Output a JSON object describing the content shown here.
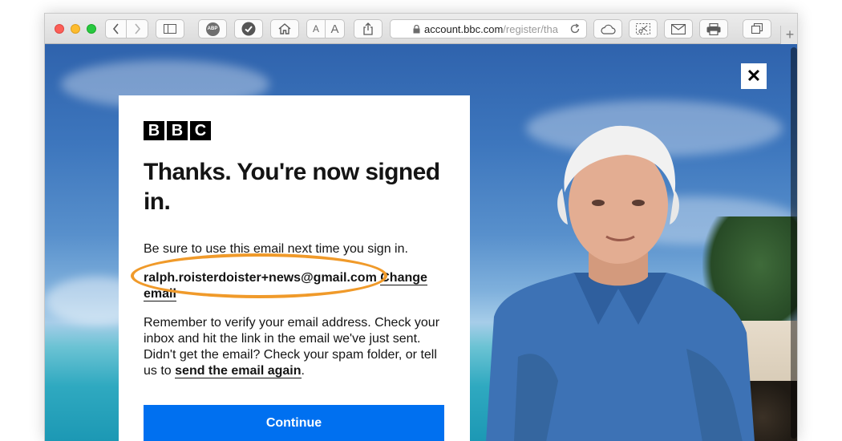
{
  "browser": {
    "address_bar": {
      "host": "account.bbc.com",
      "path_tail": "/register/tha"
    },
    "toolbar_buttons": {
      "adblock_label": "ABP",
      "font_small_label": "A",
      "font_large_label": "A",
      "new_tab_label": "+"
    }
  },
  "page": {
    "close_label": "✕",
    "logo_letters": [
      "B",
      "B",
      "C"
    ],
    "heading": "Thanks. You're now signed in.",
    "intro_text": "Be sure to use this email next time you sign in.",
    "email": "ralph.roisterdoister+news@gmail.com",
    "change_email_label": "Change email",
    "verify_text": "Remember to verify your email address. Check your inbox and hit the link in the email we've just sent. Didn't get the email? Check your spam folder, or tell us to",
    "send_again_label": "send the email again",
    "send_again_suffix": ".",
    "continue_label": "Continue"
  },
  "colors": {
    "continue_button": "#0070f0",
    "annotation_ellipse": "#f09a2a",
    "traffic_close": "#fc5f57",
    "traffic_minimize": "#fdbc2e",
    "traffic_zoom": "#28c840"
  }
}
